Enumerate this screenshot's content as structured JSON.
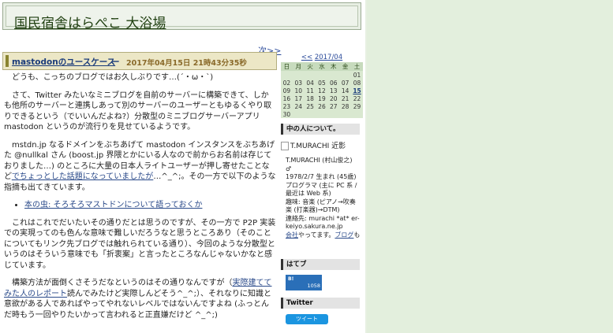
{
  "site": {
    "title": "国民宿舎はらぺこ 大浴場"
  },
  "nav": {
    "next_label": "次>>"
  },
  "entry": {
    "title": "mastodonのユースケース",
    "dash": "ー",
    "date": "2017年04月15日 21時43分35秒",
    "paragraphs": [
      "どうも、こっちのブログではお久しぶりです…(´・ω・`)",
      "さて、Twitter みたいなミニブログを自前のサーバーに構築できて、しかも他所のサーバーと連携しあって別のサーバーのユーザーともゆるくやり取りできるという（でいいんだよね?）分散型のミニブログサーバーアプリ mastodon というのが流行りを見せているようです。",
      "mstdn.jp なるドメインをぶちあげて mastodon インスタンスをぶちあげた @nullkal さん (boost.jp 界隈とかにいる人なので前からお名前は存じておりました…) のところに大量の日本人ライトユーザーが押し寄せたことなど",
      "その一方で以下のような指摘も出てきています。"
    ],
    "link_wadai": "でちょっとした話題になっていましたが",
    "wadai_suffix": "…^_^;。",
    "list_link": "本の虫: そろそろマストドンについて語っておくか",
    "para5": "これはこれでだいたいその通りだとは思うのですが、その一方で P2P 実装での実現ってのも色んな意味で難しいだろうなと思うところあり（そのことについてもリンク先ブログでは触れられている通り）、今回のような分散型というのはそういう意味でも「折衷案」と言ったところなんじゃないかなと感じています。",
    "para6_pre": "構築方法が面倒くさそうだなというのはその通りなんですが（",
    "para6_link": "実際建ててみた人のレポート",
    "para6_post": "読んでみたけど実際しんどそう^_^;）、それなりに知識と意欲がある人であればやってやれないレベルではないんですよね (ふっとんだ時もう一回やりたいかって言われると正直嫌だけど ^_^;)"
  },
  "calendar": {
    "prev_label": "<<",
    "month_label": "2017/04",
    "dow": [
      "日",
      "月",
      "火",
      "水",
      "木",
      "金",
      "土"
    ],
    "weeks": [
      [
        "",
        "",
        "",
        "",
        "",
        "",
        "01"
      ],
      [
        "02",
        "03",
        "04",
        "05",
        "06",
        "07",
        "08"
      ],
      [
        "09",
        "10",
        "11",
        "12",
        "13",
        "14",
        "15"
      ],
      [
        "16",
        "17",
        "18",
        "19",
        "20",
        "21",
        "22"
      ],
      [
        "23",
        "24",
        "25",
        "26",
        "27",
        "28",
        "29"
      ],
      [
        "30",
        "",
        "",
        "",
        "",
        "",
        ""
      ]
    ],
    "highlight": "15"
  },
  "sidebar": {
    "about_heading": "中の人について。",
    "profile_image_alt": "T.MURACHI 近影",
    "profile_lines": [
      "T.MURACHI (村山俊之)",
      "♂",
      "1978/2/7 生まれ (45歳)",
      "プログラマ (主に PC 系 / 最近は Web 系)",
      "趣味: 音楽 (ピアノ→吹奏楽 (打楽器)→DTM)",
      "連絡先: murachi *at* er-keiyo.sakura.ne.jp"
    ],
    "company_link": "会社",
    "company_mid": "やってます。",
    "blog_link": "ブログ",
    "blog_tail": "も",
    "hatebu_heading": "はてブ",
    "hatebu_count": "1058",
    "hatebu_label": "B!",
    "twitter_heading": "Twitter",
    "tweet_label": "ツイート"
  }
}
